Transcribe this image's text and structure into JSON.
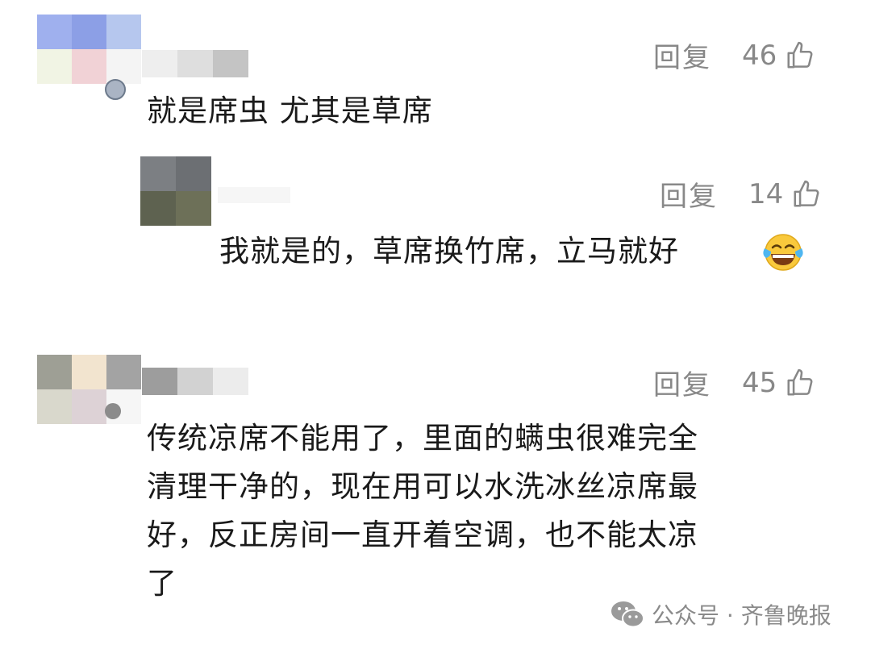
{
  "comments": [
    {
      "text": "就是席虫 尤其是草席",
      "reply_label": "回复",
      "likes": "46"
    },
    {
      "text": "我就是的，草席换竹席，立马就好",
      "reply_label": "回复",
      "likes": "14",
      "emoji": "tears-of-joy-emoji-icon"
    },
    {
      "text": "传统凉席不能用了，里面的螨虫很难完全清理干净的，现在用可以水洗冰丝凉席最好，反正房间一直开着空调，也不能太凉了",
      "text_lines": [
        "传统凉席不能用了，里面的螨虫很难完全",
        "清理干净的，现在用可以水洗冰丝凉席最",
        "好，反正房间一直开着空调，也不能太凉",
        "了"
      ],
      "reply_label": "回复",
      "likes": "45"
    }
  ],
  "watermark": {
    "text": "公众号 · 齐鲁晚报",
    "icon": "wechat-icon"
  },
  "colors": {
    "text": "#1a1a1a",
    "meta": "#888888"
  }
}
